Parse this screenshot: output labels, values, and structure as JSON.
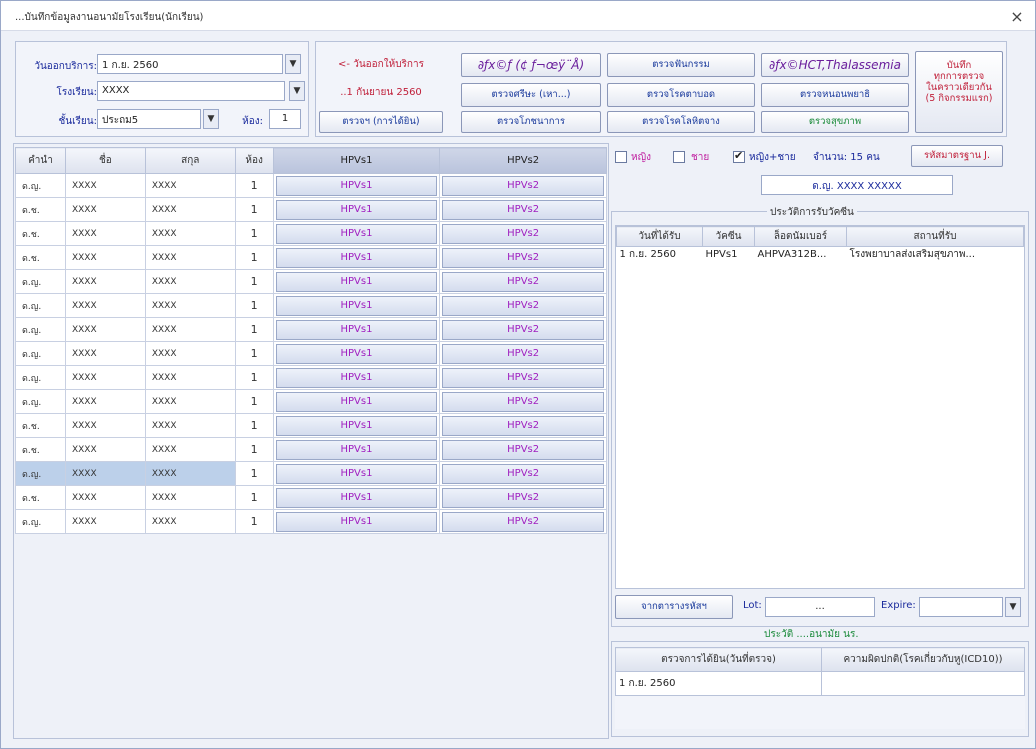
{
  "window": {
    "title": "...บันทึกข้อมูลงานอนามัยโรงเรียน(นักเรียน)",
    "close": "×"
  },
  "form": {
    "service_date_label": "วันออกบริการ:",
    "service_date_value": "1 ก.ย. 2560",
    "school_label": "โรงเรียน:",
    "school_value": "XXXX",
    "grade_label": "ชั้นเรียน:",
    "grade_value": "ประถม5",
    "room_label": "ห้อง:",
    "room_value": "1"
  },
  "hints": {
    "line1": "<- วันออกให้บริการ",
    "line2": "..1 กันยายน 2560"
  },
  "buttons": {
    "vaccine": "∂ƒx©ƒ (¢ ƒ¬œÿ¨Å)",
    "general_exam": "ตรวจฯ (การได้ยิน)",
    "exam_body": "ตรวจศรีษะ (เหา...)",
    "exam_nutrition": "ตรวจโภชนาการ",
    "exam_teeth": "ตรวจฟันกรรม",
    "exam_eye": "ตรวจโรคตาบอด",
    "exam_disease": "ตรวจโรคโลหิตจาง",
    "thalassemia": "∂ƒx©HCT,Thalassemia",
    "exam_parasite": "ตรวจหนอนพยาธิ",
    "exam_health": "ตรวจสุขภาพ",
    "save_all": "บันทึก\nทุกการตรวจ\nในคราวเดียวกัน\n(5 กิจกรรมแรก)",
    "standard_code": "รหัสมาตรฐาน J.",
    "lot_lookup": "จากตารางรหัสฯ"
  },
  "filters": {
    "female": "หญิง",
    "male": "ชาย",
    "both": "หญิง+ชาย",
    "count": "จำนวน: 15 คน"
  },
  "selected_student": "ด.ญ. XXXX XXXXX",
  "table": {
    "headers": [
      "คำนำ",
      "ชื่อ",
      "สกุล",
      "ห้อง",
      "HPVs1",
      "HPVs2"
    ],
    "rows": [
      [
        "ด.ญ.",
        "XXXX",
        "XXXX",
        "1",
        "HPVs1",
        "HPVs2"
      ],
      [
        "ด.ช.",
        "XXXX",
        "XXXX",
        "1",
        "HPVs1",
        "HPVs2"
      ],
      [
        "ด.ช.",
        "XXXX",
        "XXXX",
        "1",
        "HPVs1",
        "HPVs2"
      ],
      [
        "ด.ช.",
        "XXXX",
        "XXXX",
        "1",
        "HPVs1",
        "HPVs2"
      ],
      [
        "ด.ญ.",
        "XXXX",
        "XXXX",
        "1",
        "HPVs1",
        "HPVs2"
      ],
      [
        "ด.ญ.",
        "XXXX",
        "XXXX",
        "1",
        "HPVs1",
        "HPVs2"
      ],
      [
        "ด.ญ.",
        "XXXX",
        "XXXX",
        "1",
        "HPVs1",
        "HPVs2"
      ],
      [
        "ด.ญ.",
        "XXXX",
        "XXXX",
        "1",
        "HPVs1",
        "HPVs2"
      ],
      [
        "ด.ญ.",
        "XXXX",
        "XXXX",
        "1",
        "HPVs1",
        "HPVs2"
      ],
      [
        "ด.ญ.",
        "XXXX",
        "XXXX",
        "1",
        "HPVs1",
        "HPVs2"
      ],
      [
        "ด.ช.",
        "XXXX",
        "XXXX",
        "1",
        "HPVs1",
        "HPVs2"
      ],
      [
        "ด.ช.",
        "XXXX",
        "XXXX",
        "1",
        "HPVs1",
        "HPVs2"
      ],
      [
        "ด.ญ.",
        "XXXX",
        "XXXX",
        "1",
        "HPVs1",
        "HPVs2"
      ],
      [
        "ด.ช.",
        "XXXX",
        "XXXX",
        "1",
        "HPVs1",
        "HPVs2"
      ],
      [
        "ด.ญ.",
        "XXXX",
        "XXXX",
        "1",
        "HPVs1",
        "HPVs2"
      ]
    ],
    "selected_row": 12
  },
  "vaccine_history": {
    "title": "ประวัติการรับวัคซีน",
    "headers": [
      "วันที่ได้รับ",
      "วัคซีน",
      "ล็อตนัมเบอร์",
      "สถานที่รับ"
    ],
    "rows": [
      [
        "1 ก.ย. 2560",
        "HPVs1",
        "AHPVA312B...",
        "โรงพยาบาลส่งเสริมสุขภาพ..."
      ]
    ]
  },
  "lot": {
    "label": "Lot:",
    "value": "...",
    "expire_label": "Expire:"
  },
  "health_history": {
    "title": "ประวัติ ....อนามัย นร.",
    "headers": [
      "ตรวจการได้ยิน(วันที่ตรวจ)",
      "ความผิดปกติ(โรคเกี่ยวกับหู(ICD10))"
    ],
    "rows": [
      [
        "1 ก.ย. 2560",
        ""
      ]
    ]
  }
}
